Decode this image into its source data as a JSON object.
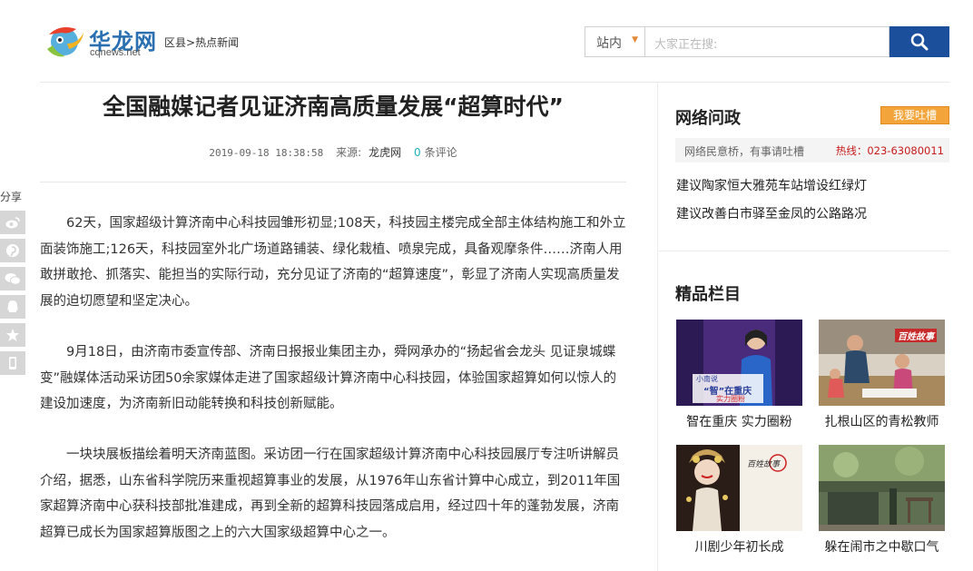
{
  "header": {
    "logo_name": "华龙网",
    "logo_url": "cqnews.net",
    "breadcrumb": [
      "区县",
      "热点新闻"
    ],
    "breadcrumb_sep": ">",
    "search": {
      "scope": "站内",
      "placeholder": "大家正在搜:"
    }
  },
  "article": {
    "title": "全国融媒记者见证济南高质量发展“超算时代”",
    "date": "2019-09-18 18:38:58",
    "source_label": "来源:",
    "source": "龙虎网",
    "comment_count": "0",
    "comment_label": "条评论",
    "paragraphs": [
      "62天，国家超级计算济南中心科技园雏形初显;108天，科技园主楼完成全部主体结构施工和外立面装饰施工;126天，科技园室外北广场道路铺装、绿化栽植、喷泉完成，具备观摩条件……济南人用敢拼敢抢、抓落实、能担当的实际行动，充分见证了济南的“超算速度”，彰显了济南人实现高质量发展的迫切愿望和坚定决心。",
      "9月18日，由济南市委宣传部、济南日报报业集团主办，舜网承办的“扬起省会龙头 见证泉城蝶变”融媒体活动采访团50余家媒体走进了国家超级计算济南中心科技园，体验国家超算如何以惊人的建设加速度，为济南新旧动能转换和科技创新赋能。",
      "一块块展板描绘着明天济南蓝图。采访团一行在国家超级计算济南中心科技园展厅专注听讲解员介绍，据悉，山东省科学院历来重视超算事业的发展，从1976年山东省计算中心成立，到2011年国家超算济南中心获科技部批准建成，再到全新的超算科技园落成启用，经过四十年的蓬勃发展，济南超算已成长为国家超算版图之上的六大国家级超算中心之一。"
    ]
  },
  "share": {
    "label": "分享",
    "icons": [
      "weibo-icon",
      "pinterest-icon",
      "wechat-icon",
      "qq-icon",
      "favorite-icon",
      "mobile-icon"
    ]
  },
  "sidebar": {
    "forum": {
      "title": "网络问政",
      "complain_button": "我要吐槽",
      "slogan": "网络民意桥，有事请吐槽",
      "hotline": "热线：023-63080011",
      "links": [
        "建议陶家恒大雅苑车站增设红绿灯",
        "建议改善白市驿至金凤的公路路况"
      ]
    },
    "featured": {
      "title": "精品栏目",
      "items": [
        {
          "caption": "智在重庆 实力圈粉",
          "overlay_lines": [
            "小南说",
            "“智”在重庆",
            "实力圈粉"
          ]
        },
        {
          "caption": "扎根山区的青松教师",
          "overlay_lines": [
            "百姓故事"
          ]
        },
        {
          "caption": "川剧少年初长成",
          "overlay_lines": [
            "百姓故事"
          ]
        },
        {
          "caption": "躲在闹市之中歇口气",
          "overlay_lines": []
        }
      ]
    }
  },
  "colors": {
    "brand_blue": "#1b4e9b",
    "accent_orange": "#f3a53b",
    "hotline_red": "#c81b1b",
    "count_teal": "#1bb0b8"
  }
}
